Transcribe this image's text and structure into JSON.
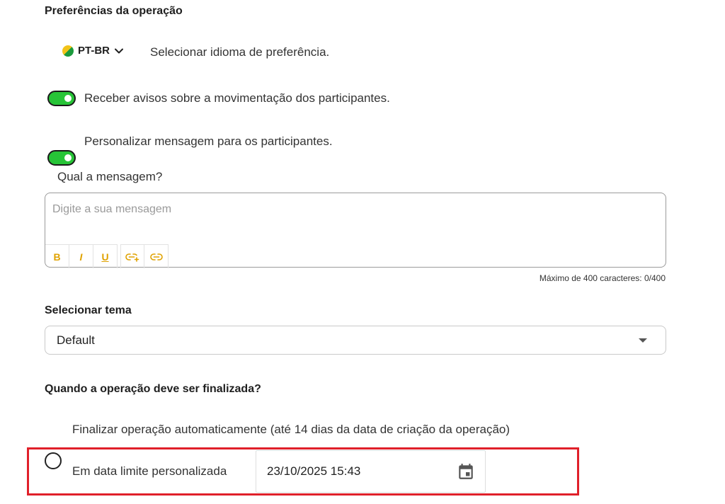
{
  "preferences": {
    "title": "Preferências da operação",
    "language": {
      "flag_icon": "brazil-flag-icon",
      "label": "PT-BR",
      "chevron_icon": "chevron-down-icon",
      "description": "Selecionar idioma de preferência."
    },
    "toggles": [
      {
        "label": "Receber avisos sobre a movimentação dos participantes.",
        "on": true
      },
      {
        "label": "Personalizar mensagem para os participantes.",
        "on": true
      }
    ],
    "toggle_color": "#27c437"
  },
  "message": {
    "question": "Qual a mensagem?",
    "placeholder": "Digite a sua mensagem",
    "value": "",
    "toolbar": {
      "bold": "B",
      "italic": "I",
      "underline": "U",
      "add_link_icon": "add-link-icon",
      "link_icon": "link-icon"
    },
    "toolbar_color": "#e0a200",
    "counter": "Máximo de 400 caracteres: 0/400"
  },
  "theme": {
    "title": "Selecionar tema",
    "selected": "Default"
  },
  "finalize": {
    "title": "Quando a operação deve ser finalizada?",
    "options": [
      {
        "label": "Finalizar operação automaticamente (até 14 dias da data de criação da operação)",
        "checked": false
      },
      {
        "label": "Em data limite personalizada",
        "checked": true
      }
    ],
    "date_value": "23/10/2025 15:43",
    "calendar_icon": "calendar-icon",
    "highlight_color": "#e0202a"
  }
}
